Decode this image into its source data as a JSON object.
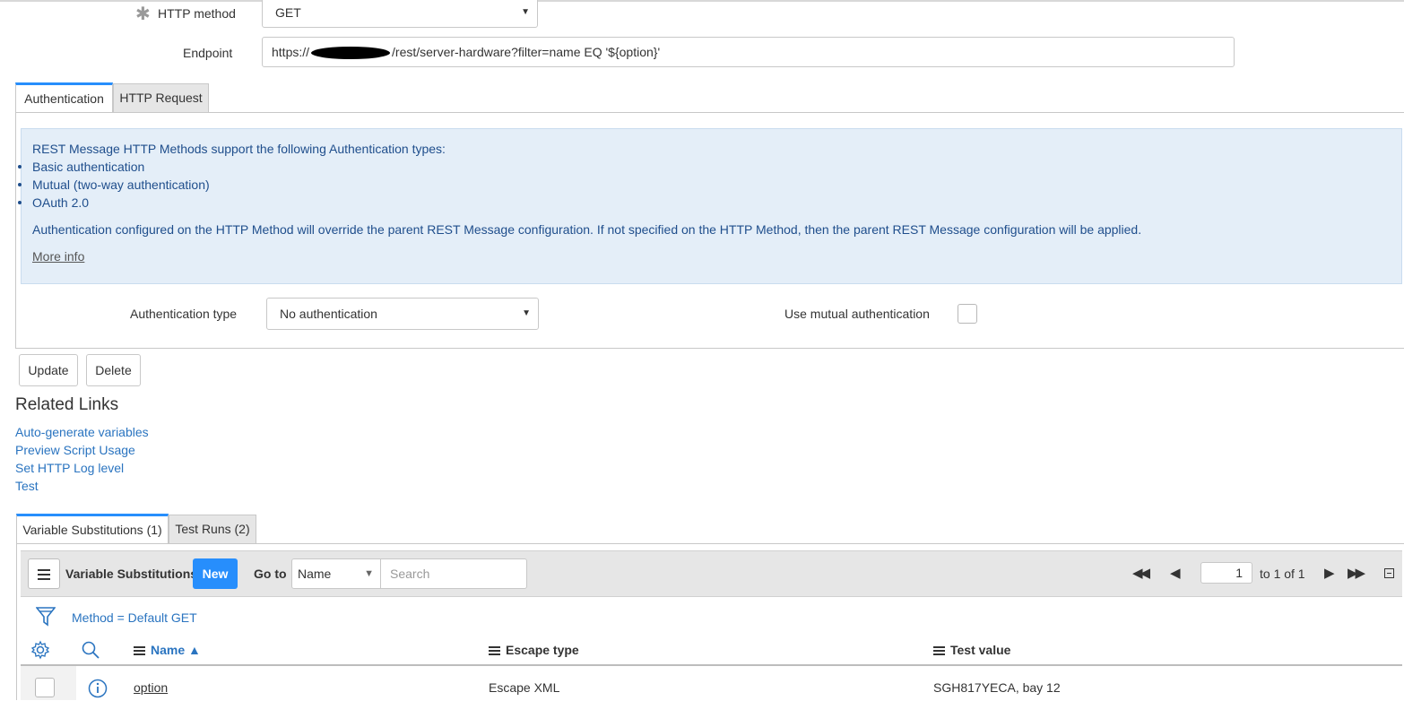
{
  "form": {
    "http_method_label": "HTTP method",
    "http_method_value": "GET",
    "endpoint_label": "Endpoint",
    "endpoint_prefix": "https://",
    "endpoint_suffix": "/rest/server-hardware?filter=name EQ '${option}'"
  },
  "tabs": [
    {
      "label": "Authentication"
    },
    {
      "label": "HTTP Request"
    }
  ],
  "info": {
    "heading": "REST Message HTTP Methods support the following Authentication types:",
    "items": [
      "Basic authentication",
      "Mutual (two-way authentication)",
      "OAuth 2.0"
    ],
    "note": "Authentication configured on the HTTP Method will override the parent REST Message configuration. If not specified on the HTTP Method, then the parent REST Message configuration will be applied.",
    "more_info": "More info"
  },
  "auth": {
    "type_label": "Authentication type",
    "type_value": "No authentication",
    "mutual_label": "Use mutual authentication"
  },
  "buttons": {
    "update": "Update",
    "delete": "Delete"
  },
  "related": {
    "title": "Related Links",
    "links": [
      "Auto-generate variables",
      "Preview Script Usage",
      "Set HTTP Log level",
      "Test"
    ]
  },
  "bottom_tabs": [
    {
      "label": "Variable Substitutions (1)"
    },
    {
      "label": "Test Runs (2)"
    }
  ],
  "list": {
    "title": "Variable Substitutions",
    "new_label": "New",
    "goto_label": "Go to",
    "goto_field": "Name",
    "search_placeholder": "Search",
    "page_value": "1",
    "page_range": "to 1 of 1",
    "filter_text": "Method = Default GET",
    "columns": [
      "Name ▲",
      "Escape type",
      "Test value"
    ],
    "rows": [
      {
        "name": "option",
        "escape_type": "Escape XML",
        "test_value": "SGH817YECA, bay 12"
      }
    ]
  }
}
